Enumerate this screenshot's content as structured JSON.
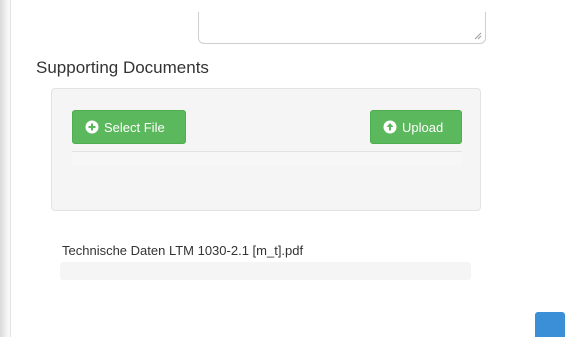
{
  "supporting_documents": {
    "title": "Supporting Documents",
    "select_button_label": "Select File",
    "upload_button_label": "Upload",
    "files": [
      {
        "name": "Technische Daten LTM 1030-2.1 [m_t].pdf",
        "progress": 0
      }
    ]
  },
  "icons": {
    "select": "plus-circle-icon",
    "upload": "arrow-up-circle-icon",
    "resize": "resize-grip-icon"
  },
  "colors": {
    "button_green": "#5cb85c",
    "well_background": "#f5f5f5",
    "scroll_button_blue": "#3a8fd6"
  }
}
